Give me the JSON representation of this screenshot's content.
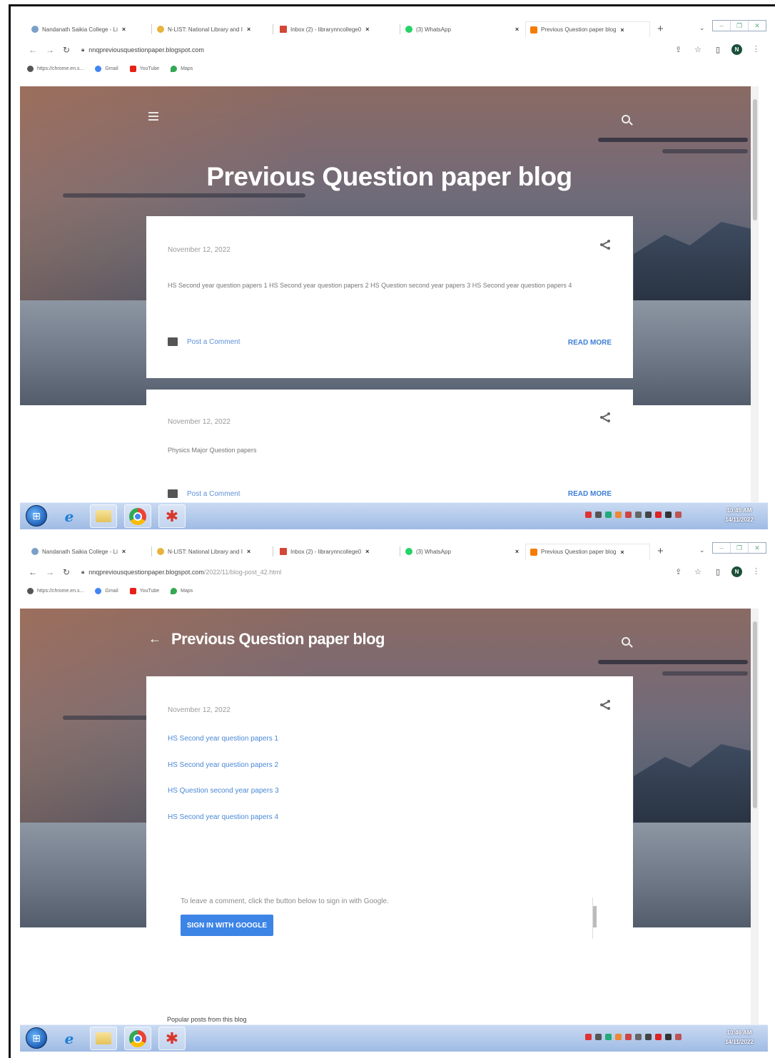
{
  "browser": {
    "tabs": [
      {
        "label": "Nandanath Saikia College - Li",
        "color": "#7aa0c8"
      },
      {
        "label": "N-LIST: National Library and I",
        "color": "#e7b33c"
      },
      {
        "label": "Inbox (2) - librarynncollege0",
        "color": "#d44638"
      },
      {
        "label": "(3) WhatsApp",
        "color": "#25d366"
      },
      {
        "label": "Previous Question paper blog",
        "color": "#f57c00"
      }
    ],
    "close_glyph": "×",
    "new_tab_glyph": "+",
    "url_host_1": "nnqpreviousquestionpaper.blogspot.com",
    "url_host_2": "nnqpreviousquestionpaper.blogspot.com",
    "url_path_2": "/2022/11/blog-post_42.html",
    "bookmarks": [
      {
        "label": "https://chrome.en.s...",
        "color": "#555555"
      },
      {
        "label": "Gmail",
        "color": "#4285f4"
      },
      {
        "label": "YouTube",
        "color": "#e62117"
      },
      {
        "label": "Maps",
        "color": "#34a853"
      }
    ],
    "profile_initial": "N"
  },
  "blog": {
    "title": "Previous Question paper blog",
    "posts": [
      {
        "date": "November 12, 2022",
        "snippet": "HS Second year question papers  1  HS Second year question papers 2 HS Question second year papers  3 HS Second year question papers 4",
        "comment_label": "Post a Comment",
        "read_more": "READ MORE"
      },
      {
        "date": "November 12, 2022",
        "snippet": "Physics Major Question papers",
        "comment_label": "Post a Comment",
        "read_more": "READ MORE"
      }
    ]
  },
  "post_page": {
    "date": "November 12, 2022",
    "links": [
      "HS Second year question papers 1",
      "HS Second year question papers 2",
      "HS Question second year papers 3",
      "HS Second year question papers 4"
    ],
    "comment_prompt": "To leave a comment, click the button below to sign in with Google.",
    "signin_label": "SIGN IN WITH GOOGLE",
    "popular_heading": "Popular posts from this blog"
  },
  "taskbar": {
    "clock_1_time": "10:45 AM",
    "clock_1_date": "14/11/2022",
    "clock_2_time": "10:46 AM",
    "clock_2_date": "14/11/2022"
  }
}
